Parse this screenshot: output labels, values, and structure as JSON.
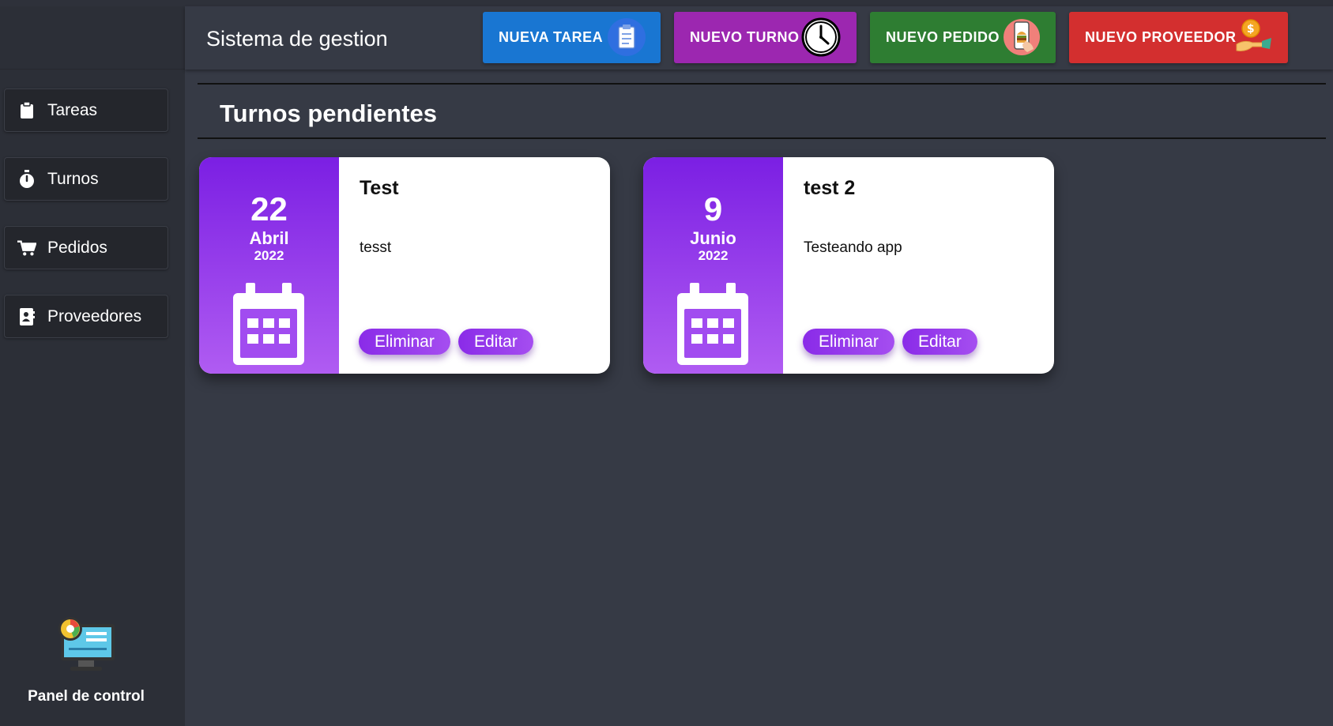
{
  "app": {
    "title": "Sistema de gestion"
  },
  "header_buttons": [
    {
      "label": "NUEVA TAREA",
      "color": "#1976d2",
      "icon": "clipboard-icon"
    },
    {
      "label": "NUEVO TURNO",
      "color": "#9c27b0",
      "icon": "clock-icon"
    },
    {
      "label": "NUEVO PEDIDO",
      "color": "#2e7d32",
      "icon": "phone-burger-icon"
    },
    {
      "label": "NUEVO PROVEEDOR",
      "color": "#d32f2f",
      "icon": "hand-coin-icon"
    }
  ],
  "sidebar": {
    "items": [
      {
        "label": "Tareas",
        "icon": "clipboard-icon"
      },
      {
        "label": "Turnos",
        "icon": "stopwatch-icon"
      },
      {
        "label": "Pedidos",
        "icon": "cart-icon"
      },
      {
        "label": "Proveedores",
        "icon": "contact-book-icon"
      }
    ],
    "panel": {
      "label": "Panel de control",
      "icon": "dashboard-monitor-icon"
    }
  },
  "main": {
    "section_title": "Turnos pendientes",
    "cards": [
      {
        "day": "22",
        "month": "Abril",
        "year": "2022",
        "title": "Test",
        "description": "tesst",
        "delete_label": "Eliminar",
        "edit_label": "Editar"
      },
      {
        "day": "9",
        "month": "Junio",
        "year": "2022",
        "title": "test 2",
        "description": "Testeando app",
        "delete_label": "Eliminar",
        "edit_label": "Editar"
      }
    ]
  },
  "colors": {
    "background": "#363a45",
    "sidebar": "#2c2f37",
    "accent": "#8a2be8"
  }
}
